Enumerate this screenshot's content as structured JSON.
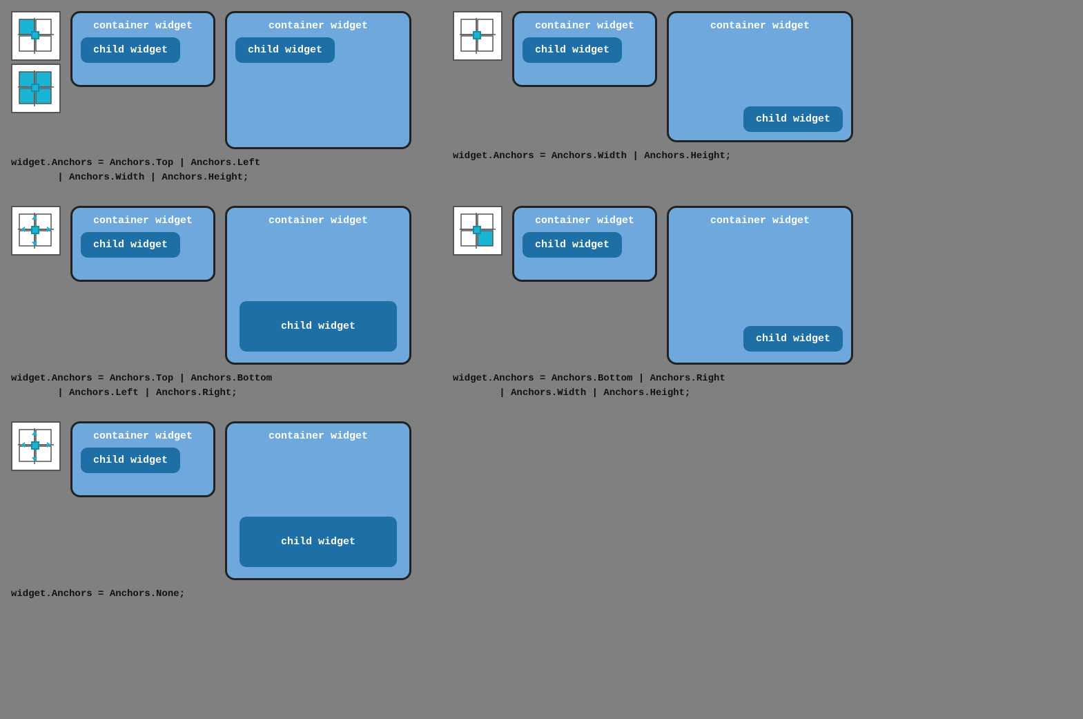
{
  "examples": [
    {
      "id": "ex1",
      "icon_type": "top_left",
      "has_stack": true,
      "container1": {
        "label": "container widget",
        "child_label": "child widget",
        "style": "small"
      },
      "container2": {
        "label": "container widget",
        "child_label": "child widget",
        "style": "medium",
        "child_position": "top"
      },
      "code": "widget.Anchors = Anchors.Top | Anchors.Left\n        | Anchors.Width | Anchors.Height;"
    },
    {
      "id": "ex2",
      "icon_type": "top_left_empty",
      "has_stack": false,
      "container1": {
        "label": "container widget",
        "child_label": "child widget",
        "style": "small"
      },
      "container2": {
        "label": "container widget",
        "child_label": "child widget",
        "style": "tall_right",
        "child_position": "bottom_right"
      },
      "code": "widget.Anchors = Anchors.Width | Anchors.Height;"
    },
    {
      "id": "ex3",
      "icon_type": "center",
      "has_stack": false,
      "container1": {
        "label": "container widget",
        "child_label": "child widget",
        "style": "small"
      },
      "container2": {
        "label": "container widget",
        "child_label": "child widget",
        "style": "tall_center",
        "child_position": "center"
      },
      "code": "widget.Anchors = Anchors.Top | Anchors.Bottom\n        | Anchors.Left | Anchors.Right;"
    },
    {
      "id": "ex4",
      "icon_type": "bottom_right",
      "has_stack": false,
      "container1": {
        "label": "container widget",
        "child_label": "child widget",
        "style": "small"
      },
      "container2": {
        "label": "container widget",
        "child_label": "child widget",
        "style": "tall_right",
        "child_position": "bottom_right"
      },
      "code": "widget.Anchors = Anchors.Bottom | Anchors.Right\n        | Anchors.Width | Anchors.Height;"
    },
    {
      "id": "ex5",
      "icon_type": "center",
      "has_stack": false,
      "container1": {
        "label": "container widget",
        "child_label": "child widget",
        "style": "small"
      },
      "container2": {
        "label": "container widget",
        "child_label": "child widget",
        "style": "tall_center",
        "child_position": "center"
      },
      "code": "widget.Anchors = Anchors.None;"
    }
  ]
}
